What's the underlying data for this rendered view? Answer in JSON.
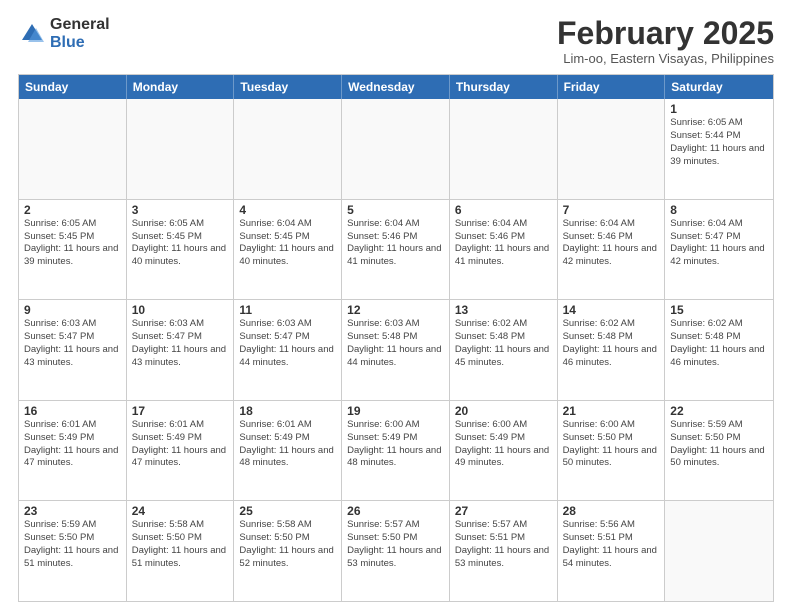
{
  "header": {
    "logo_general": "General",
    "logo_blue": "Blue",
    "month_title": "February 2025",
    "subtitle": "Lim-oo, Eastern Visayas, Philippines"
  },
  "calendar": {
    "days_of_week": [
      "Sunday",
      "Monday",
      "Tuesday",
      "Wednesday",
      "Thursday",
      "Friday",
      "Saturday"
    ],
    "weeks": [
      [
        {
          "day": "",
          "info": ""
        },
        {
          "day": "",
          "info": ""
        },
        {
          "day": "",
          "info": ""
        },
        {
          "day": "",
          "info": ""
        },
        {
          "day": "",
          "info": ""
        },
        {
          "day": "",
          "info": ""
        },
        {
          "day": "1",
          "info": "Sunrise: 6:05 AM\nSunset: 5:44 PM\nDaylight: 11 hours and 39 minutes."
        }
      ],
      [
        {
          "day": "2",
          "info": "Sunrise: 6:05 AM\nSunset: 5:45 PM\nDaylight: 11 hours and 39 minutes."
        },
        {
          "day": "3",
          "info": "Sunrise: 6:05 AM\nSunset: 5:45 PM\nDaylight: 11 hours and 40 minutes."
        },
        {
          "day": "4",
          "info": "Sunrise: 6:04 AM\nSunset: 5:45 PM\nDaylight: 11 hours and 40 minutes."
        },
        {
          "day": "5",
          "info": "Sunrise: 6:04 AM\nSunset: 5:46 PM\nDaylight: 11 hours and 41 minutes."
        },
        {
          "day": "6",
          "info": "Sunrise: 6:04 AM\nSunset: 5:46 PM\nDaylight: 11 hours and 41 minutes."
        },
        {
          "day": "7",
          "info": "Sunrise: 6:04 AM\nSunset: 5:46 PM\nDaylight: 11 hours and 42 minutes."
        },
        {
          "day": "8",
          "info": "Sunrise: 6:04 AM\nSunset: 5:47 PM\nDaylight: 11 hours and 42 minutes."
        }
      ],
      [
        {
          "day": "9",
          "info": "Sunrise: 6:03 AM\nSunset: 5:47 PM\nDaylight: 11 hours and 43 minutes."
        },
        {
          "day": "10",
          "info": "Sunrise: 6:03 AM\nSunset: 5:47 PM\nDaylight: 11 hours and 43 minutes."
        },
        {
          "day": "11",
          "info": "Sunrise: 6:03 AM\nSunset: 5:47 PM\nDaylight: 11 hours and 44 minutes."
        },
        {
          "day": "12",
          "info": "Sunrise: 6:03 AM\nSunset: 5:48 PM\nDaylight: 11 hours and 44 minutes."
        },
        {
          "day": "13",
          "info": "Sunrise: 6:02 AM\nSunset: 5:48 PM\nDaylight: 11 hours and 45 minutes."
        },
        {
          "day": "14",
          "info": "Sunrise: 6:02 AM\nSunset: 5:48 PM\nDaylight: 11 hours and 46 minutes."
        },
        {
          "day": "15",
          "info": "Sunrise: 6:02 AM\nSunset: 5:48 PM\nDaylight: 11 hours and 46 minutes."
        }
      ],
      [
        {
          "day": "16",
          "info": "Sunrise: 6:01 AM\nSunset: 5:49 PM\nDaylight: 11 hours and 47 minutes."
        },
        {
          "day": "17",
          "info": "Sunrise: 6:01 AM\nSunset: 5:49 PM\nDaylight: 11 hours and 47 minutes."
        },
        {
          "day": "18",
          "info": "Sunrise: 6:01 AM\nSunset: 5:49 PM\nDaylight: 11 hours and 48 minutes."
        },
        {
          "day": "19",
          "info": "Sunrise: 6:00 AM\nSunset: 5:49 PM\nDaylight: 11 hours and 48 minutes."
        },
        {
          "day": "20",
          "info": "Sunrise: 6:00 AM\nSunset: 5:49 PM\nDaylight: 11 hours and 49 minutes."
        },
        {
          "day": "21",
          "info": "Sunrise: 6:00 AM\nSunset: 5:50 PM\nDaylight: 11 hours and 50 minutes."
        },
        {
          "day": "22",
          "info": "Sunrise: 5:59 AM\nSunset: 5:50 PM\nDaylight: 11 hours and 50 minutes."
        }
      ],
      [
        {
          "day": "23",
          "info": "Sunrise: 5:59 AM\nSunset: 5:50 PM\nDaylight: 11 hours and 51 minutes."
        },
        {
          "day": "24",
          "info": "Sunrise: 5:58 AM\nSunset: 5:50 PM\nDaylight: 11 hours and 51 minutes."
        },
        {
          "day": "25",
          "info": "Sunrise: 5:58 AM\nSunset: 5:50 PM\nDaylight: 11 hours and 52 minutes."
        },
        {
          "day": "26",
          "info": "Sunrise: 5:57 AM\nSunset: 5:50 PM\nDaylight: 11 hours and 53 minutes."
        },
        {
          "day": "27",
          "info": "Sunrise: 5:57 AM\nSunset: 5:51 PM\nDaylight: 11 hours and 53 minutes."
        },
        {
          "day": "28",
          "info": "Sunrise: 5:56 AM\nSunset: 5:51 PM\nDaylight: 11 hours and 54 minutes."
        },
        {
          "day": "",
          "info": ""
        }
      ]
    ]
  }
}
